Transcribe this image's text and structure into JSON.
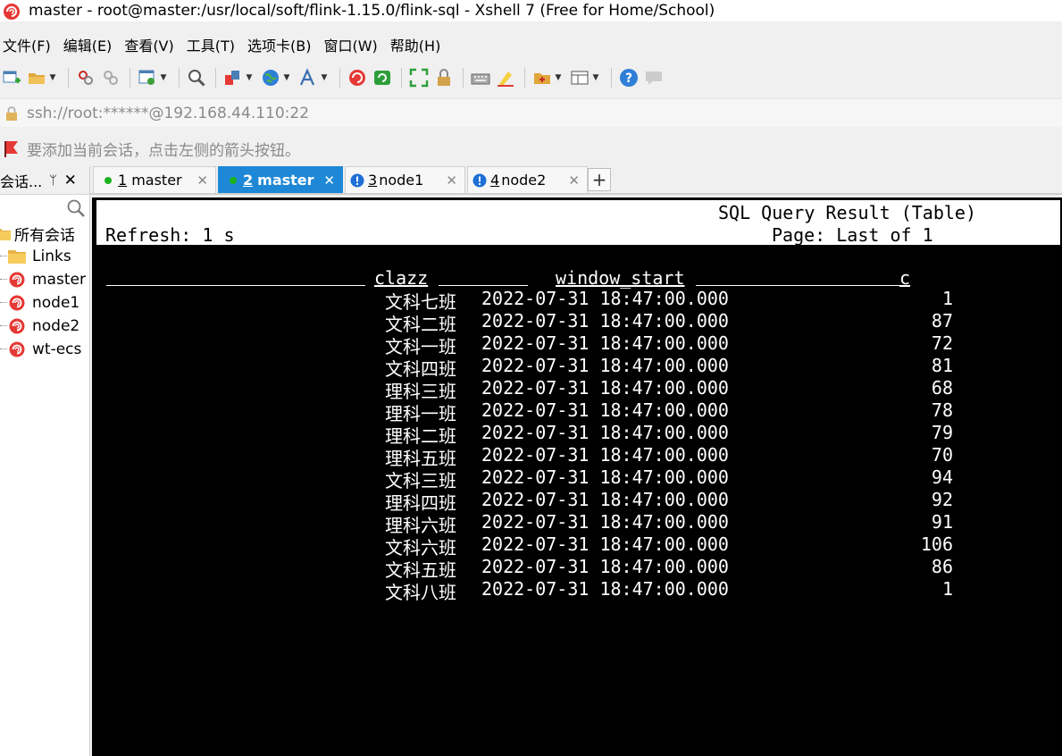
{
  "window": {
    "title": "master - root@master:/usr/local/soft/flink-1.15.0/flink-sql - Xshell 7 (Free for Home/School)"
  },
  "menu": [
    "文件(F)",
    "编辑(E)",
    "查看(V)",
    "工具(T)",
    "选项卡(B)",
    "窗口(W)",
    "帮助(H)"
  ],
  "address": {
    "text": "ssh://root:******@192.168.44.110:22"
  },
  "hint": {
    "text": "要添加当前会话，点击左侧的箭头按钮。"
  },
  "sidebar": {
    "title": "会话...",
    "pin": "ᛘ",
    "close": "✕",
    "root_label": "所有会话",
    "items": [
      {
        "label": "Links",
        "icon": "folder-icon"
      },
      {
        "label": "master",
        "icon": "session-icon"
      },
      {
        "label": "node1",
        "icon": "session-icon"
      },
      {
        "label": "node2",
        "icon": "session-icon"
      },
      {
        "label": "wt-ecs",
        "icon": "session-icon"
      }
    ]
  },
  "tabs": [
    {
      "num": "1",
      "label": "master",
      "status": "connected",
      "active": false
    },
    {
      "num": "2",
      "label": "master",
      "status": "connected",
      "active": true
    },
    {
      "num": "3",
      "label": "node1",
      "status": "warning",
      "active": false
    },
    {
      "num": "4",
      "label": "node2",
      "status": "warning",
      "active": false
    }
  ],
  "tab_close": "✕",
  "tab_add": "+",
  "terminal": {
    "refresh": "Refresh: 1 s",
    "title": "SQL Query Result (Table)",
    "page": "Page: Last of 1",
    "columns": {
      "clazz": "clazz",
      "window_start": "window_start",
      "c": "c"
    },
    "rows": [
      {
        "clazz": "文科七班",
        "window_start": "2022-07-31 18:47:00.000",
        "c": "1"
      },
      {
        "clazz": "文科二班",
        "window_start": "2022-07-31 18:47:00.000",
        "c": "87"
      },
      {
        "clazz": "文科一班",
        "window_start": "2022-07-31 18:47:00.000",
        "c": "72"
      },
      {
        "clazz": "文科四班",
        "window_start": "2022-07-31 18:47:00.000",
        "c": "81"
      },
      {
        "clazz": "理科三班",
        "window_start": "2022-07-31 18:47:00.000",
        "c": "68"
      },
      {
        "clazz": "理科一班",
        "window_start": "2022-07-31 18:47:00.000",
        "c": "78"
      },
      {
        "clazz": "理科二班",
        "window_start": "2022-07-31 18:47:00.000",
        "c": "79"
      },
      {
        "clazz": "理科五班",
        "window_start": "2022-07-31 18:47:00.000",
        "c": "70"
      },
      {
        "clazz": "文科三班",
        "window_start": "2022-07-31 18:47:00.000",
        "c": "94"
      },
      {
        "clazz": "理科四班",
        "window_start": "2022-07-31 18:47:00.000",
        "c": "92"
      },
      {
        "clazz": "理科六班",
        "window_start": "2022-07-31 18:47:00.000",
        "c": "91"
      },
      {
        "clazz": "文科六班",
        "window_start": "2022-07-31 18:47:00.000",
        "c": "106"
      },
      {
        "clazz": "文科五班",
        "window_start": "2022-07-31 18:47:00.000",
        "c": "86"
      },
      {
        "clazz": "文科八班",
        "window_start": "2022-07-31 18:47:00.000",
        "c": "1"
      }
    ]
  },
  "colors": {
    "active_tab": "#1e88d6",
    "connected_dot": "#1db31d",
    "warning_icon": "#1e6fd6",
    "terminal_bg": "#000000",
    "terminal_fg": "#ffffff"
  },
  "toolbar_icons": [
    "new-session-icon",
    "open-folder-icon",
    "reconnect-icon",
    "disconnect-icon",
    "properties-icon",
    "find-icon",
    "transfer-icon",
    "globe-icon",
    "font-icon",
    "xshell-icon",
    "xftp-icon",
    "fullscreen-icon",
    "lock-icon",
    "keyboard-icon",
    "highlight-icon",
    "script-icon",
    "layout-icon",
    "help-icon",
    "chat-icon"
  ]
}
